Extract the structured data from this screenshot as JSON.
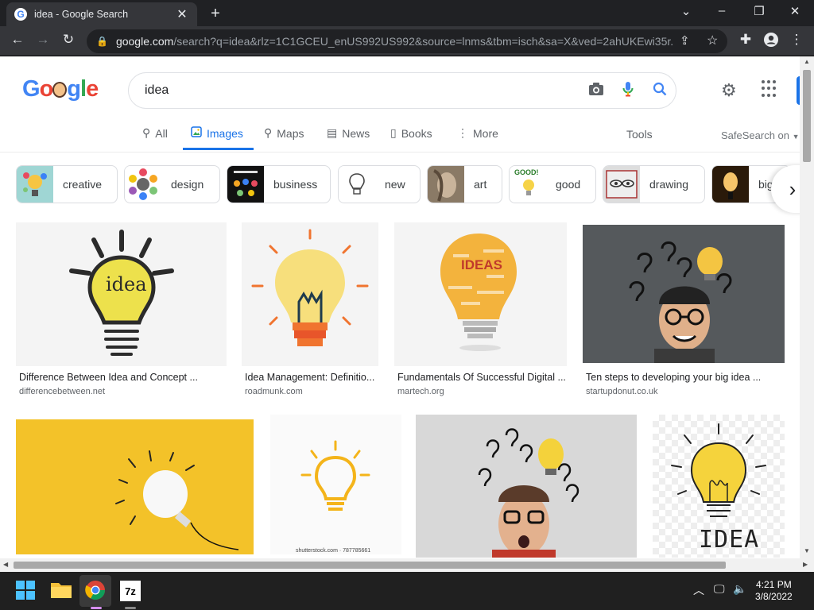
{
  "browser": {
    "tab_title": "idea - Google Search",
    "tab_favicon": "google-g",
    "new_tab": "+",
    "url_host": "google.com",
    "url_rest": "/search?q=idea&rlz=1C1GCEU_enUS992US992&source=lnms&tbm=isch&sa=X&ved=2ahUKEwi35r..."
  },
  "search": {
    "query": "idea"
  },
  "nav": {
    "all": "All",
    "images": "Images",
    "maps": "Maps",
    "news": "News",
    "books": "Books",
    "more": "More",
    "tools": "Tools",
    "safesearch": "SafeSearch on"
  },
  "chips": [
    {
      "label": "creative"
    },
    {
      "label": "design"
    },
    {
      "label": "business"
    },
    {
      "label": "new"
    },
    {
      "label": "art"
    },
    {
      "label": "good"
    },
    {
      "label": "drawing"
    },
    {
      "label": "big"
    }
  ],
  "results": [
    {
      "caption": "Difference Between Idea and Concept ...",
      "source": "differencebetween.net"
    },
    {
      "caption": "Idea Management: Definitio...",
      "source": "roadmunk.com"
    },
    {
      "caption": "Fundamentals Of Successful Digital ...",
      "source": "martech.org"
    },
    {
      "caption": "Ten steps to developing your big idea ...",
      "source": "startupdonut.co.uk"
    },
    {
      "caption": "",
      "source": ""
    },
    {
      "caption": "",
      "source": ""
    },
    {
      "caption": "",
      "source": ""
    },
    {
      "caption": "",
      "source": ""
    }
  ],
  "image_text": {
    "idea_bulb_word": "idea",
    "wordcloud_word": "IDEAS",
    "shutterstock": "shutterstock.com · 787785661",
    "idea_caps": "IDEA",
    "chip_good_word": "GOOD!"
  },
  "taskbar": {
    "time": "4:21 PM",
    "date": "3/8/2022",
    "archiver_label": "7z"
  },
  "colors": {
    "accent": "#1a73e8",
    "titlebar": "#202124",
    "toolbar": "#35363a"
  }
}
